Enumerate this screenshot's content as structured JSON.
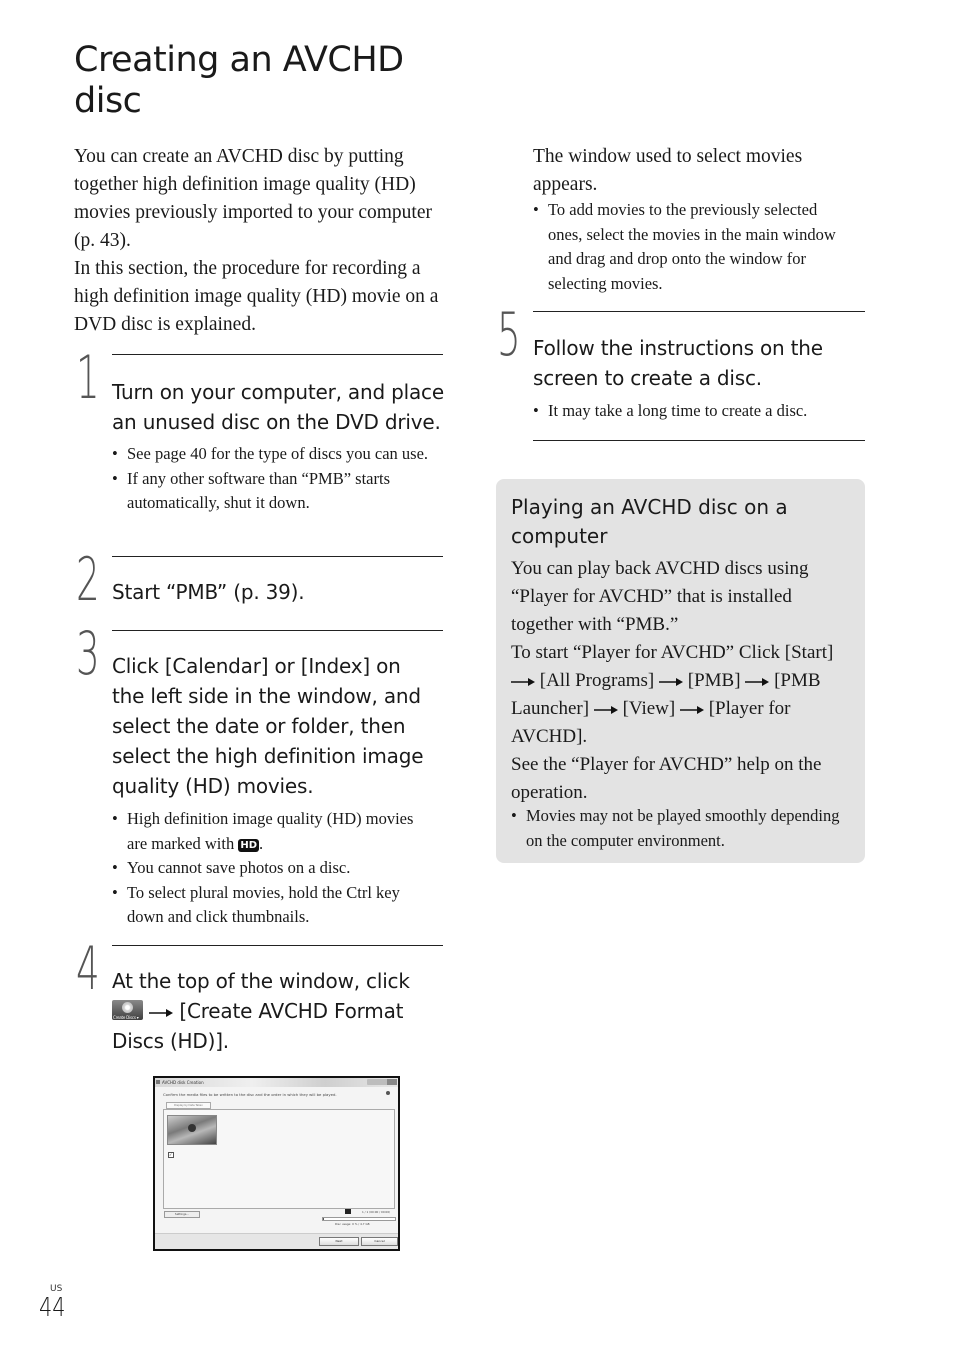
{
  "page": {
    "title": "Creating an AVCHD disc",
    "intro": [
      "You can create an AVCHD disc by putting together high definition image quality (HD) movies previously imported to your computer (p. 43).",
      "In this section, the procedure for recording a high definition image quality (HD) movie on a DVD disc is explained."
    ],
    "language_code": "US",
    "page_number": "44"
  },
  "steps": [
    {
      "number": "1",
      "heading": "Turn on your computer, and place an unused disc on the DVD drive.",
      "bullets": [
        "See page 40 for the type of discs you can use.",
        "If any other software than “PMB” starts automatically, shut it down."
      ]
    },
    {
      "number": "2",
      "heading": "Start “PMB” (p. 39).",
      "bullets": []
    },
    {
      "number": "3",
      "heading": "Click [Calendar] or [Index] on the left side in the window, and select the date or folder, then select the high definition image quality (HD) movies.",
      "bullets": [
        "High definition image quality (HD) movies are marked with",
        "You cannot save photos on a disc.",
        "To select plural movies, hold the Ctrl key down and click thumbnails."
      ],
      "hd_badge": "HD"
    },
    {
      "number": "4",
      "heading_before_icon": "At the top of the window, click",
      "icon_label": "Create Discs ▾",
      "heading_after_icon": "[Create AVCHD Format Discs (HD)].",
      "result_text": "The window used to select movies appears.",
      "bullets": [
        "To add movies to the previously selected ones, select the movies in the main window and drag and drop onto the window for selecting movies."
      ]
    },
    {
      "number": "5",
      "heading": "Follow the instructions on the screen to create a disc.",
      "bullets": [
        "It may take a long time to create a disc."
      ]
    }
  ],
  "screenshot": {
    "window_title": "AVCHD disk Creation",
    "instruction": "Confirm the media files to be written to the disc and the order in which they will be played.",
    "sort_button": "Display by Date Taken",
    "settings_button": "Settings...",
    "duration": "1 / 1 (00:00 / 00:00)",
    "disc_usage_label": "Disc usage: 0 % / 4.7 GB",
    "disc_usage_fraction": 0.02,
    "next_button": "Next",
    "cancel_button": "Cancel"
  },
  "tip": {
    "title": "Playing an AVCHD disc on a computer",
    "para1": "You can play back AVCHD discs using “Player for AVCHD” that is installed together with “PMB.”",
    "para2_intro": "To start “Player for AVCHD” Click",
    "menu_path": [
      "[Start]",
      "[All Programs]",
      "[PMB]",
      "[PMB Launcher]",
      "[View]",
      "[Player for AVCHD]."
    ],
    "para3": "See the “Player for AVCHD” help on the operation.",
    "bullets": [
      "Movies may not be played smoothly depending on the computer environment."
    ]
  }
}
